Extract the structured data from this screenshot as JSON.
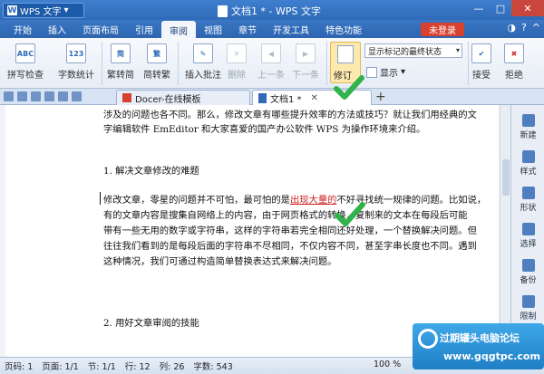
{
  "titlebar": {
    "app_name": "WPS 文字",
    "doc_title": "文档1 * - WPS 文字"
  },
  "menu": {
    "items": [
      "开始",
      "插入",
      "页面布局",
      "引用",
      "审阅",
      "视图",
      "章节",
      "开发工具",
      "特色功能"
    ],
    "active": "审阅",
    "login_label": "未登录"
  },
  "ribbon": {
    "spell_check": "拼写检查",
    "word_count": "字数统计",
    "trad_to_simp": "繁转简",
    "simp_to_trad": "简转繁",
    "insert_comment": "插入批注",
    "delete": "删除",
    "prev": "上一条",
    "next": "下一条",
    "revise": "修订",
    "status_select": "显示标记的最终状态",
    "show": "显示",
    "accept": "接受",
    "reject": "拒绝",
    "icon_abc": "ABC",
    "icon_123": "123"
  },
  "tabs": [
    {
      "label": "Docer-在线模板",
      "active": false
    },
    {
      "label": "文档1 *",
      "active": true
    }
  ],
  "document": {
    "lines": [
      "涉及的问题也各不同。那么，修改文章有哪些提升效率的方法或技巧？就让我们用经典的文",
      "字编辑软件 EmEditor 和大家喜爱的国产办公软件 WPS 为操作环境来介绍。",
      "1. 解决文章修改的难题",
      "有的文章内容是搜集自网络上的内容，由于网页格式的转换，复制来的文本在每段后可能",
      "带有一些无用的数字或字符串，这样的字符串若完全相同还好处理，一个替换解决问题。但",
      "往往我们看到的是每段后面的字符串不尽相同，不仅内容不同，甚至字串长度也不同。遇到",
      "这种情况，我们可通过构造简单替换表达式来解决问题。",
      "2. 用好文章审阅的技能"
    ],
    "para1_before": "修改文章，零星的问题并不可怕，最可怕的是",
    "para1_red": "出现大量的",
    "para1_after": "不好寻找统一规律的问题。比如说，"
  },
  "sidebar": {
    "items": [
      "新建",
      "样式",
      "形状",
      "选择",
      "备份",
      "限制"
    ]
  },
  "statusbar": {
    "page_no": "页码: 1",
    "pages": "页面: 1/1",
    "section": "节: 1/1",
    "row": "行: 12",
    "col": "列: 26",
    "chars": "字数: 543",
    "zoom": "100 %"
  },
  "watermark": {
    "line1": "过期罐头电脑论坛",
    "line2": "www.gqgtpc.com"
  },
  "colors": {
    "accent": "#2f6bb8",
    "login": "#d9412f",
    "check": "#2fb34a",
    "revision_red": "#cc2222"
  }
}
